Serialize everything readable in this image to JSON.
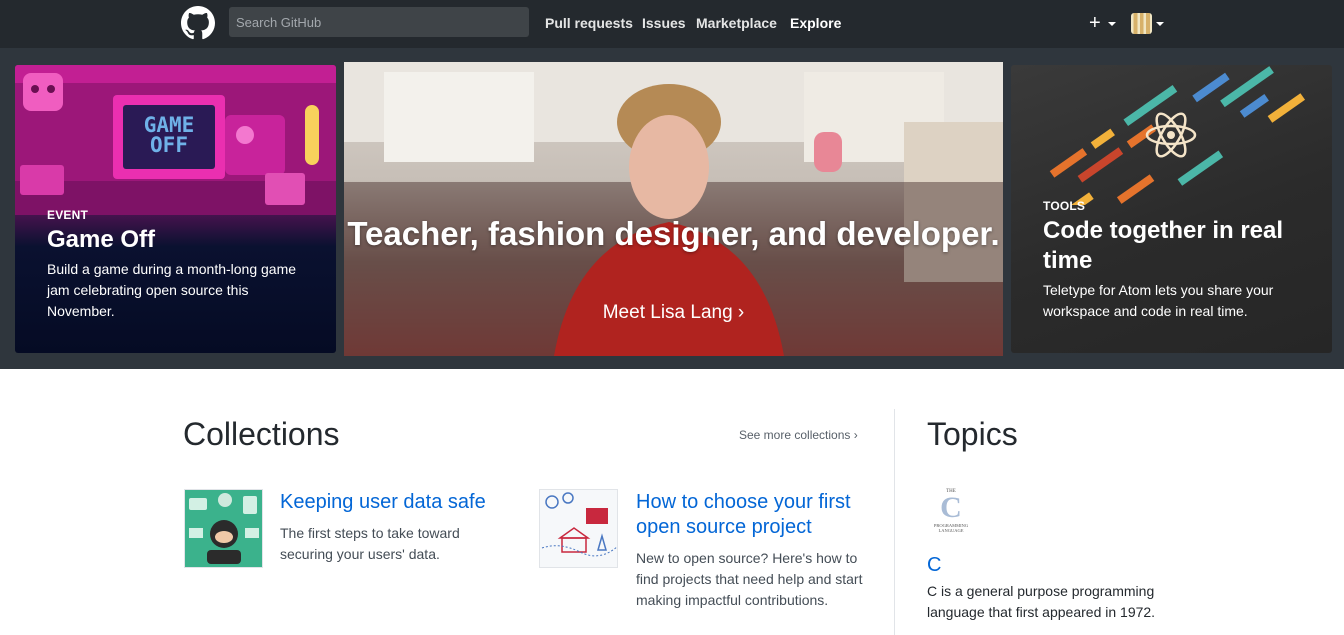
{
  "header": {
    "search_placeholder": "Search GitHub",
    "nav": [
      "Pull requests",
      "Issues",
      "Marketplace",
      "Explore"
    ],
    "plus_label": "+"
  },
  "hero": {
    "game_off": {
      "eyebrow": "EVENT",
      "title": "Game Off",
      "description": "Build a game during a month-long game jam celebrating open source this November.",
      "art_text": "GAME OFF"
    },
    "feature": {
      "headline": "Teacher, fashion designer, and developer.",
      "link": "Meet Lisa Lang ›"
    },
    "atom": {
      "eyebrow": "TOOLS",
      "title": "Code together in real time",
      "description": "Teletype for Atom lets you share your workspace and code in real time."
    }
  },
  "collections": {
    "title": "Collections",
    "see_more": "See more collections ›",
    "items": [
      {
        "title": "Keeping user data safe",
        "description": "The first steps to take toward securing your users' data."
      },
      {
        "title": "How to choose your first open source project",
        "description": "New to open source? Here's how to find projects that need help and start making impactful contributions."
      }
    ]
  },
  "topics": {
    "title": "Topics",
    "items": [
      {
        "logo_text_top": "THE",
        "logo_letter": "C",
        "logo_text_bottom": "PROGRAMMING LANGUAGE",
        "title": "C",
        "description": "C is a general purpose programming language that first appeared in 1972."
      }
    ]
  },
  "colors": {
    "header_bg": "#24292e",
    "hero_bg": "#2f363d",
    "link": "#0366d6",
    "game_magenta": "#b51a8a"
  }
}
